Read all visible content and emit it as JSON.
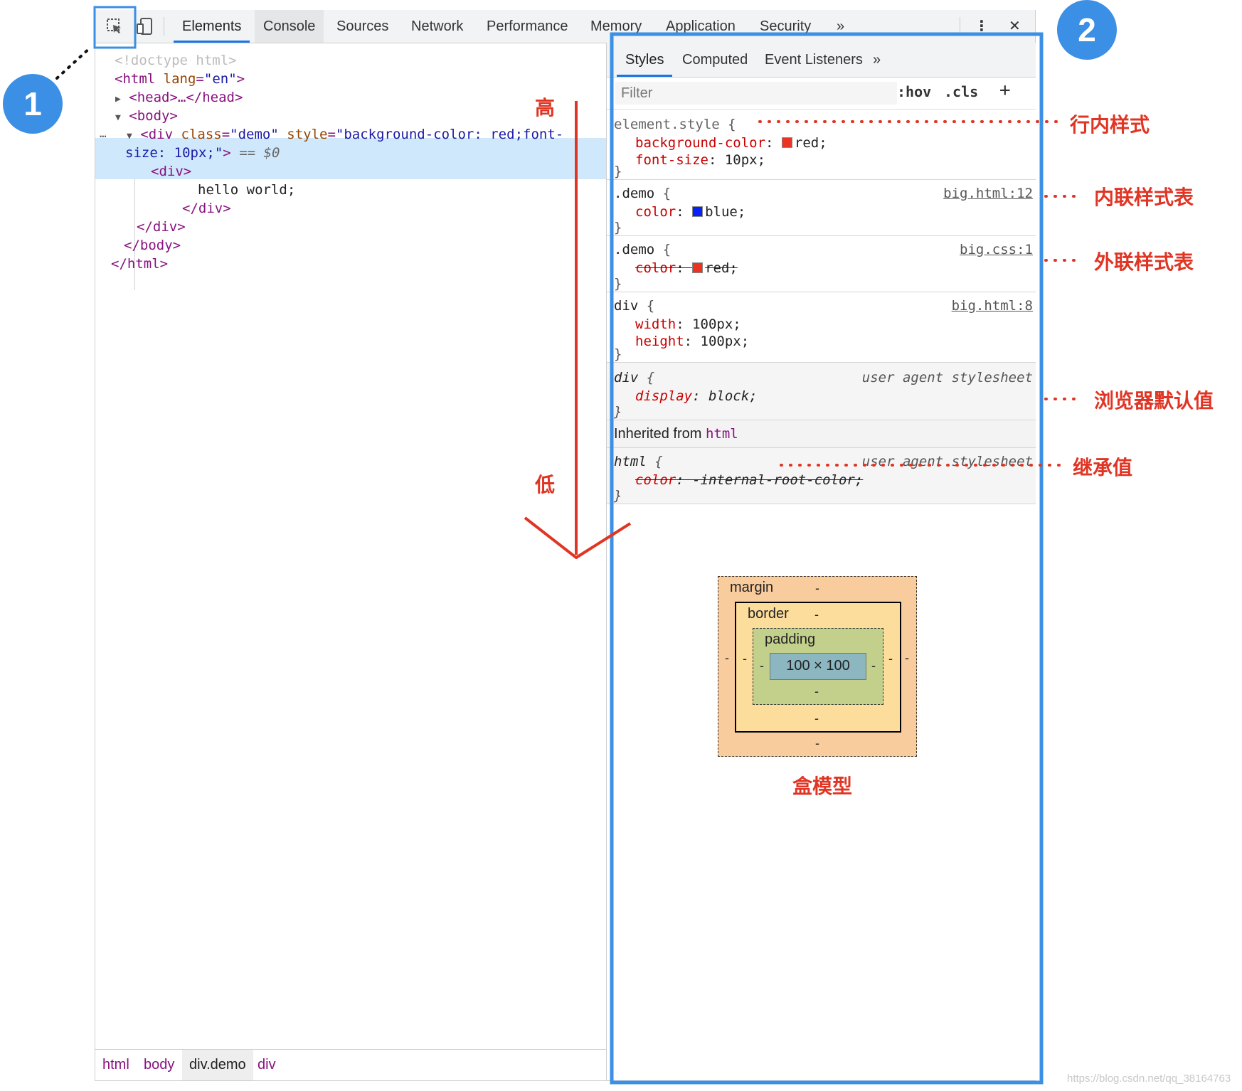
{
  "toolbar": {
    "tabs": [
      "Elements",
      "Console",
      "Sources",
      "Network",
      "Performance",
      "Memory",
      "Application",
      "Security"
    ],
    "more": "»",
    "menu": "⋮",
    "close": "✕"
  },
  "dom": {
    "doctype": "<!doctype html>",
    "html_open": "<html",
    "html_lang_attr": "lang",
    "html_lang_val": "\"en\"",
    "head": "<head>…</head>",
    "body_open": "<body>",
    "div_open_tag": "<div",
    "div_class_attr": "class",
    "div_class_val": "\"demo\"",
    "div_style_attr": "style",
    "div_style_val_1": "\"background-color: red;font-",
    "div_style_val_2": "size: 10px;\"",
    "div_eq": "== $0",
    "inner_div_open": "<div>",
    "hello": "hello world;",
    "inner_div_close": "</div>",
    "div_close": "</div>",
    "body_close": "</body>",
    "html_close": "</html>",
    "ellipsis": "…"
  },
  "breadcrumbs": [
    "html",
    "body",
    "div.demo",
    "div"
  ],
  "styles": {
    "tabs": [
      "Styles",
      "Computed",
      "Event Listeners"
    ],
    "more": "»",
    "filter_placeholder": "Filter",
    "hov": ":hov",
    "cls": ".cls",
    "plus": "+",
    "rules": [
      {
        "selector": "element.style",
        "source": "",
        "props": [
          {
            "name": "background-color",
            "value": "red",
            "swatch": "#ea3323"
          },
          {
            "name": "font-size",
            "value": "10px"
          }
        ]
      },
      {
        "selector": ".demo",
        "source": "big.html:12",
        "props": [
          {
            "name": "color",
            "value": "blue",
            "swatch": "#0a21f5"
          }
        ]
      },
      {
        "selector": ".demo",
        "source": "big.css:1",
        "props": [
          {
            "name": "color",
            "value": "red",
            "swatch": "#ea3323",
            "overridden": true
          }
        ]
      },
      {
        "selector": "div",
        "source": "big.html:8",
        "props": [
          {
            "name": "width",
            "value": "100px"
          },
          {
            "name": "height",
            "value": "100px"
          }
        ]
      },
      {
        "selector": "div",
        "source": "user agent stylesheet",
        "props": [
          {
            "name": "display",
            "value": "block"
          }
        ]
      }
    ],
    "inherited_label": "Inherited from",
    "inherited_tag": "html",
    "inherited_rule": {
      "selector": "html",
      "source": "user agent stylesheet",
      "props": [
        {
          "name": "color",
          "value": "-internal-root-color",
          "overridden": true
        }
      ]
    },
    "box_model": {
      "margin_label": "margin",
      "border_label": "border",
      "padding_label": "padding",
      "content": "100 × 100",
      "dash": "-"
    }
  },
  "annotations": {
    "badge_1": "1",
    "badge_2": "2",
    "high": "高",
    "low": "低",
    "inline_style": "行内样式",
    "internal_sheet": "内联样式表",
    "external_sheet": "外联样式表",
    "ua_default": "浏览器默认值",
    "inherited": "继承值",
    "box_model": "盒模型"
  },
  "colors": {
    "annotation_red": "#e03524",
    "highlight_blue": "#3b8fe4",
    "selection_bg": "#cfe8fc"
  },
  "watermark": "https://blog.csdn.net/qq_38164763"
}
